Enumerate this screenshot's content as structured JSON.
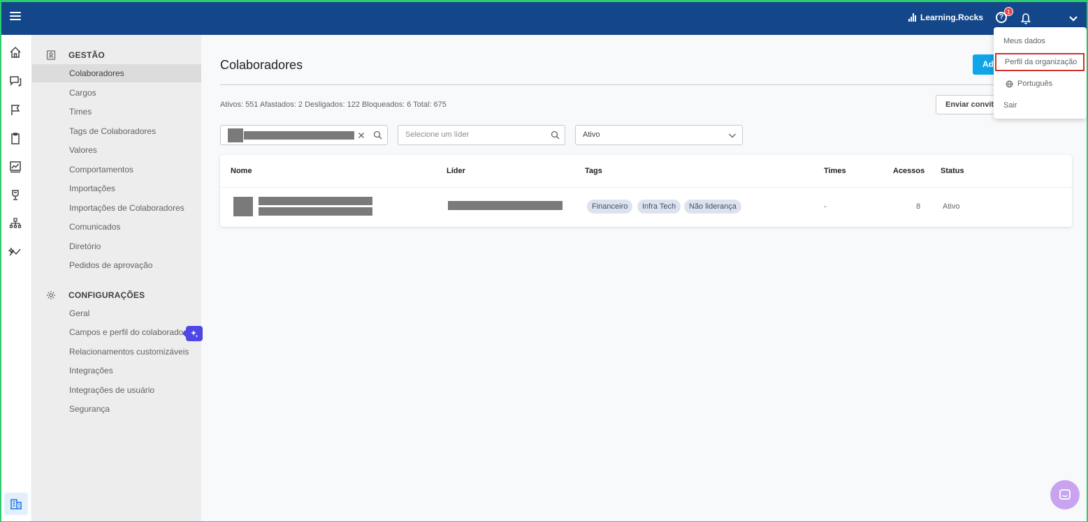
{
  "topbar": {
    "brand": "Learning.Rocks",
    "help_badge_count": "1"
  },
  "sidebar": {
    "sections": [
      {
        "title": "GESTÃO",
        "items": [
          {
            "label": "Colaboradores",
            "active": true
          },
          {
            "label": "Cargos"
          },
          {
            "label": "Times"
          },
          {
            "label": "Tags de Colaboradores"
          },
          {
            "label": "Valores"
          },
          {
            "label": "Comportamentos"
          },
          {
            "label": "Importações"
          },
          {
            "label": "Importações de Colaboradores"
          },
          {
            "label": "Comunicados"
          },
          {
            "label": "Diretório"
          },
          {
            "label": "Pedidos de aprovação"
          }
        ]
      },
      {
        "title": "CONFIGURAÇÕES",
        "items": [
          {
            "label": "Geral"
          },
          {
            "label": "Campos e perfil do colaborador"
          },
          {
            "label": "Relacionamentos customizáveis"
          },
          {
            "label": "Integrações"
          },
          {
            "label": "Integrações de usuário"
          },
          {
            "label": "Segurança"
          }
        ]
      }
    ]
  },
  "main": {
    "title": "Colaboradores",
    "add_button_label": "Ad",
    "stats": "Ativos: 551  Afastados: 2  Desligados: 122  Bloqueados: 6  Total: 675",
    "invite_button_label": "Enviar convit",
    "filters": {
      "search_value": "",
      "leader_placeholder": "Selecione um líder",
      "status_value": "Ativo"
    },
    "table": {
      "columns": [
        "Nome",
        "Líder",
        "Tags",
        "Times",
        "Acessos",
        "Status"
      ],
      "rows": [
        {
          "tags": [
            "Financeiro",
            "Infra Tech",
            "Não liderança"
          ],
          "times": "-",
          "acessos": "8",
          "status": "Ativo"
        }
      ]
    }
  },
  "user_menu": {
    "items": [
      "Meus dados",
      "Perfil da organização",
      "Português",
      "Sair"
    ],
    "highlighted": "Perfil da organização"
  },
  "colors": {
    "topbar": "#14478a",
    "primary_button": "#0ea5e9",
    "highlight_border": "#d32f2f",
    "ai_badge": "#4f46e5",
    "chat_button": "#c9a3f0"
  }
}
